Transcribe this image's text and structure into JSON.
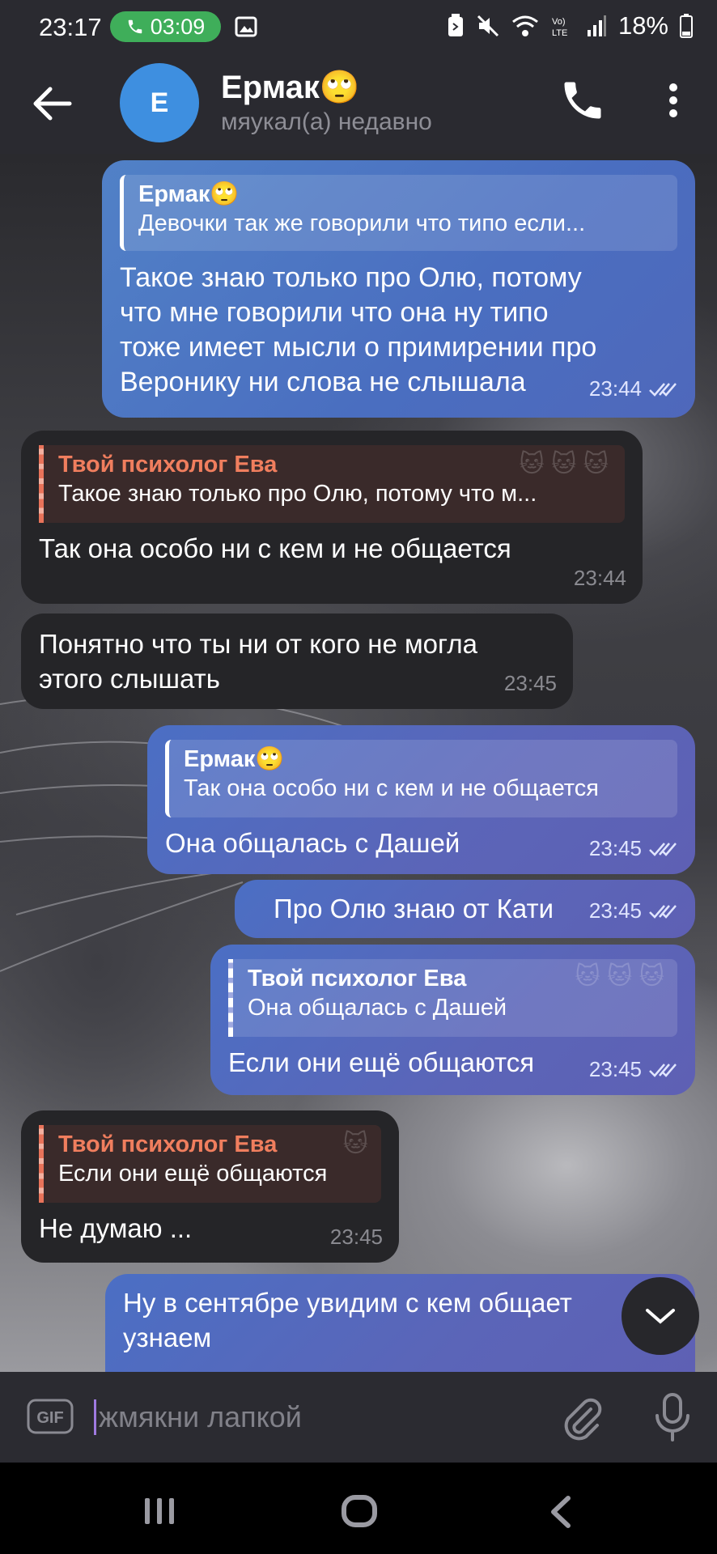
{
  "status_bar": {
    "time": "23:17",
    "call_timer": "03:09",
    "battery": "18%"
  },
  "header": {
    "avatar_letter": "E",
    "name": "Ермак🙄",
    "status": "мяукал(а) недавно"
  },
  "messages": [
    {
      "id": "m1",
      "direction": "out",
      "reply_name": "Ермак🙄",
      "reply_text": "Девочки так же говорили что типо если...",
      "lines": [
        "Такое знаю только про Олю, потому",
        "что мне говорили что она ну типо",
        "тоже имеет мысли о примирении про",
        "Веронику ни слова не слышала"
      ],
      "time": "23:44",
      "read": true
    },
    {
      "id": "m2",
      "direction": "in",
      "reply_name": "Твой психолог Ева",
      "reply_text": "Такое знаю только про Олю, потому что м...",
      "lines": [
        "Так она особо ни с кем и не общается"
      ],
      "time": "23:44"
    },
    {
      "id": "m3",
      "direction": "in",
      "lines": [
        "Понятно что ты ни от кого не могла",
        "этого слышать"
      ],
      "time": "23:45"
    },
    {
      "id": "m4",
      "direction": "out",
      "reply_name": "Ермак🙄",
      "reply_text": "Так она особо ни с кем и не общается",
      "lines": [
        "Она общалась с Дашей"
      ],
      "time": "23:45",
      "read": true
    },
    {
      "id": "m5",
      "direction": "out",
      "lines": [
        "Про Олю знаю от Кати"
      ],
      "time": "23:45",
      "read": true
    },
    {
      "id": "m6",
      "direction": "out",
      "reply_name": "Твой психолог Ева",
      "reply_text": "Она общалась с Дашей",
      "lines": [
        "Если они ещё общаются"
      ],
      "time": "23:45",
      "read": true
    },
    {
      "id": "m7",
      "direction": "in",
      "reply_name": "Твой психолог Ева",
      "reply_text": "Если они ещё общаются",
      "lines": [
        "Не думаю ..."
      ],
      "time": "23:45"
    },
    {
      "id": "m8",
      "direction": "out",
      "lines": [
        "Ну в сентябре увидим с кем общает",
        "узнаем"
      ]
    }
  ],
  "input": {
    "placeholder": "жмякни лапкой",
    "gif_label": "GIF"
  },
  "colors": {
    "outgoing_bubble": "#5b65b8",
    "incoming_bubble": "#252528",
    "reply_name_incoming": "#f07e5e",
    "avatar": "#3e8fe0",
    "call_pill": "#3fae5a"
  },
  "icons": [
    "back-arrow-icon",
    "phone-icon",
    "more-vertical-icon",
    "double-check-icon",
    "chevron-down-icon",
    "paperclip-icon",
    "microphone-icon",
    "gif-icon"
  ]
}
